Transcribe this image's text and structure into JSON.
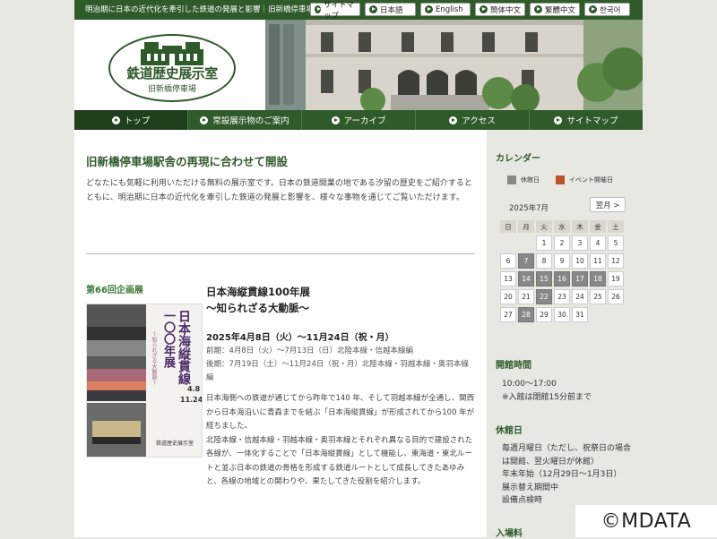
{
  "topbar": {
    "tagline": "明治期に日本の近代化を牽引した鉄道の発展と影響｜旧新橋停車場",
    "links": [
      "サイトマップ",
      "日本語",
      "English",
      "簡体中文",
      "繁體中文",
      "한국어"
    ]
  },
  "logo": {
    "title": "鉄道歴史展示室",
    "subtitle": "旧新橋停車場"
  },
  "nav": [
    "トップ",
    "常設展示物のご案内",
    "アーカイブ",
    "アクセス",
    "サイトマップ"
  ],
  "main": {
    "heading": "旧新橋停車場駅舎の再現に合わせて開設",
    "intro": "どなたにも気軽に利用いただける無料の展示室です。日本の鉄道開業の地である汐留の歴史をご紹介するとともに、明治期に日本の近代化を牽引した鉄道の発展と影響を、様々な事物を通じてご覧いただけます。",
    "exhibition": {
      "label": "第66回企画展",
      "title_line1": "日本海縦貫線100年展",
      "title_line2": "～知られざる大動脈～",
      "date": "2025年4月8日（火）～11月24日（祝・月）",
      "period_1": "前期：4月8日（火）～7月13日（日）北陸本線・信越本線編",
      "period_2": "後期：7月19日（土）～11月24日（祝・月）北陸本線・羽越本線・奥羽本線編",
      "desc_1": "日本海側への鉄道が通じてから昨年で140 年、そして羽越本線が全通し、関西から日本海沿いに青森までを結ぶ「日本海縦貫線」が形成されてから100 年が経ちました。",
      "desc_2": "北陸本線・信越本線・羽越本線・奥羽本線とそれぞれ異なる目的で建設された各線が、一体化することで「日本海縦貫線」として機能し、東海道・東北ルートと並ぶ日本の鉄道の骨格を形成する鉄道ルートとして成長してきたあゆみと、各線の地域との関わりや、果たしてきた役割を紹介します。",
      "poster": {
        "title": "日本海縦貫線",
        "subtitle": "一〇〇年展",
        "tagline": "～知られざる大動脈～",
        "date_start": "4.8",
        "date_end": "11.24",
        "venue": "鉄道歴史展示室"
      }
    }
  },
  "sidebar": {
    "calendar_title": "カレンダー",
    "legend": [
      {
        "label": "休館日",
        "color": "#888888"
      },
      {
        "label": "イベント開催日",
        "color": "#c0502a"
      }
    ],
    "month": "2025年7月",
    "next_label": "翌月 >",
    "weekdays": [
      "日",
      "月",
      "火",
      "水",
      "木",
      "金",
      "土"
    ],
    "weeks": [
      [
        "",
        "",
        "1",
        "2",
        "3",
        "4",
        "5"
      ],
      [
        "6",
        "7",
        "8",
        "9",
        "10",
        "11",
        "12"
      ],
      [
        "13",
        "14",
        "15",
        "16",
        "17",
        "18",
        "19"
      ],
      [
        "20",
        "21",
        "22",
        "23",
        "24",
        "25",
        "26"
      ],
      [
        "27",
        "28",
        "29",
        "30",
        "31",
        "",
        ""
      ]
    ],
    "closed_days": [
      "7",
      "14",
      "15",
      "16",
      "17",
      "18",
      "22",
      "28"
    ],
    "hours_title": "開館時間",
    "hours": "10:00～17:00",
    "hours_note": "※入館は閉館15分前まで",
    "closed_title": "休館日",
    "closed_1": "毎週月曜日（ただし、祝祭日の場合は開館、翌火曜日が休館）",
    "closed_2": "年末年始（12月29日～1月3日）",
    "closed_3": "展示替え期間中",
    "closed_4": "設備点検時",
    "fee_title": "入場料"
  },
  "copyright": "©MDATA"
}
